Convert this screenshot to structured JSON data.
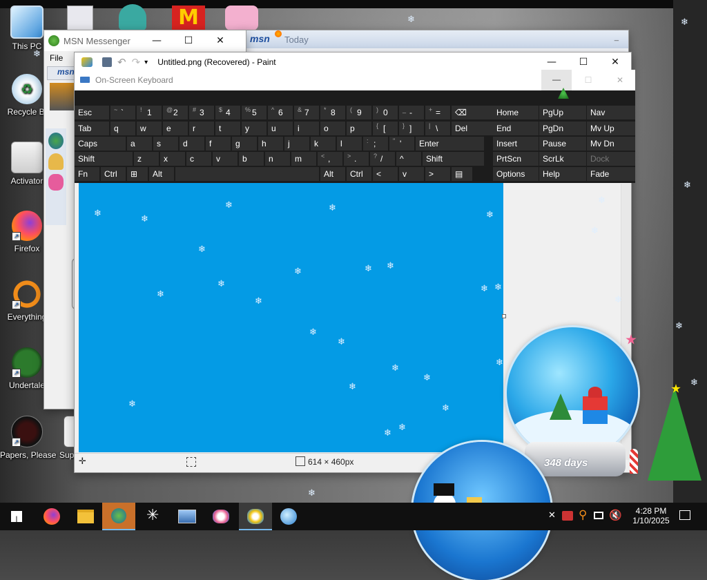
{
  "desktop": {
    "icons": [
      {
        "label": "This PC",
        "icon": "computer-icon"
      },
      {
        "label": "Recycle Bi",
        "icon": "recycle-bin-icon"
      },
      {
        "label": "Activator",
        "icon": "activator-icon"
      },
      {
        "label": "Firefox",
        "icon": "firefox-icon"
      },
      {
        "label": "Everything",
        "icon": "everything-search-icon"
      },
      {
        "label": "Undertale",
        "icon": "undertale-icon"
      },
      {
        "label": "Papers, Please",
        "icon": "papers-please-icon"
      },
      {
        "label": "Supe",
        "icon": "game-icon"
      }
    ]
  },
  "msn_messenger": {
    "title": "MSN Messenger",
    "menu_file": "File",
    "logo": "msn"
  },
  "msn_today": {
    "title": "Today",
    "logo": "msn"
  },
  "paint": {
    "title": "Untitled.png (Recovered) - Paint",
    "status_dimensions": "614 × 460px"
  },
  "osk": {
    "title": "On-Screen Keyboard",
    "rows": [
      [
        "Esc",
        "~ `",
        "! 1",
        "@ 2",
        "# 3",
        "$ 4",
        "% 5",
        "^ 6",
        "& 7",
        "* 8",
        "( 9",
        ") 0",
        "_ -",
        "+ =",
        "⌫"
      ],
      [
        "Tab",
        "q",
        "w",
        "e",
        "r",
        "t",
        "y",
        "u",
        "i",
        "o",
        "p",
        "{ [",
        "} ]",
        "| \\",
        "Del"
      ],
      [
        "Caps",
        "a",
        "s",
        "d",
        "f",
        "g",
        "h",
        "j",
        "k",
        "l",
        ": ;",
        "\" '",
        "Enter"
      ],
      [
        "Shift",
        "z",
        "x",
        "c",
        "v",
        "b",
        "n",
        "m",
        "< ,",
        "> .",
        "? /",
        "^",
        "Shift"
      ],
      [
        "Fn",
        "Ctrl",
        "⊞",
        "Alt",
        "",
        "Alt",
        "Ctrl",
        "<",
        "v",
        ">",
        "▤"
      ]
    ],
    "nav_keys": [
      [
        "Home",
        "PgUp",
        "Nav"
      ],
      [
        "End",
        "PgDn",
        "Mv Up"
      ],
      [
        "Insert",
        "Pause",
        "Mv Dn"
      ],
      [
        "PrtScn",
        "ScrLk",
        "Dock"
      ],
      [
        "Options",
        "Help",
        "Fade"
      ]
    ]
  },
  "snowglobe": {
    "days_text": "348 days"
  },
  "taskbar": {
    "items": [
      "start-icon",
      "firefox-icon",
      "file-explorer-icon",
      "msn-messenger-icon",
      "on-screen-keyboard-icon",
      "network-icon",
      "paint-icon",
      "paint-app-icon",
      "media-icon"
    ],
    "clock_time": "4:28 PM",
    "clock_date": "1/10/2025"
  }
}
